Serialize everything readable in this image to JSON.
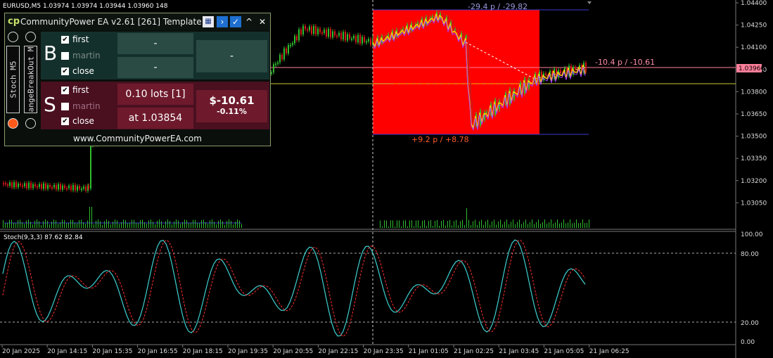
{
  "symbol_header": "EURUSD,M5  1.03974 1.03974 1.03944 1.03960  148",
  "price_axis": [
    "1.04400",
    "1.04250",
    "1.04100",
    "1.03950",
    "1.03800",
    "1.03650",
    "1.03500",
    "1.03350",
    "1.03200",
    "1.03050"
  ],
  "current_price": "1.03960",
  "top_box_label": "-29.4 p / -29.82",
  "bottom_box_label": "+9.2 p / +8.78",
  "right_label": "-10.4 p / -10.61",
  "stoch_label": "Stoch(9,3,3) 87.62 82.84",
  "stoch_axis": [
    "100.00",
    "80.00",
    "20.00",
    "0.00"
  ],
  "time_axis": [
    "20 Jan 2025",
    "20 Jan 14:15",
    "20 Jan 15:35",
    "20 Jan 16:55",
    "20 Jan 18:15",
    "20 Jan 19:35",
    "20 Jan 20:55",
    "20 Jan 22:15",
    "20 Jan 23:35",
    "21 Jan 01:05",
    "21 Jan 02:25",
    "21 Jan 03:45",
    "21 Jan 05:05",
    "21 Jan 06:25"
  ],
  "colors": {
    "bull": "#2fbd2f",
    "bear": "#d01818",
    "box": "#ff0000",
    "stoch_main": "#3fd0d0",
    "stoch_signal": "#ff3030"
  },
  "panel": {
    "title": "CommunityPower EA v2.61 [261] Template",
    "tab1": "Stoch M5",
    "tab2": "angeBreakOut M",
    "buy": {
      "letter": "B",
      "first": "first",
      "martin": "martin",
      "close": "close",
      "cell_top": "-",
      "cell_bottom": "-",
      "cell_right": "-"
    },
    "sell": {
      "letter": "S",
      "first": "first",
      "martin": "martin",
      "close": "close",
      "lots": "0.10 lots [1]",
      "at": "at 1.03854",
      "pl": "$-10.61",
      "pct": "-0.11%"
    },
    "footer": "www.CommunityPowerEA.com"
  }
}
